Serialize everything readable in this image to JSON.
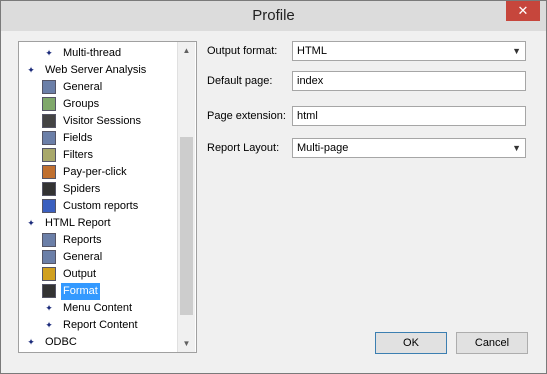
{
  "window": {
    "title": "Profile",
    "close_glyph": "✕"
  },
  "tree": {
    "items": [
      {
        "label": "Multi-thread",
        "icon": "bullet-icon"
      },
      {
        "label": "Web Server Analysis",
        "icon": "bullet-icon"
      },
      {
        "label": "General",
        "icon": "settings-icon"
      },
      {
        "label": "Groups",
        "icon": "groups-icon"
      },
      {
        "label": "Visitor Sessions",
        "icon": "visitor-icon"
      },
      {
        "label": "Fields",
        "icon": "fields-icon"
      },
      {
        "label": "Filters",
        "icon": "filters-icon"
      },
      {
        "label": "Pay-per-click",
        "icon": "pay-per-click-icon"
      },
      {
        "label": "Spiders",
        "icon": "spider-icon"
      },
      {
        "label": "Custom reports",
        "icon": "custom-reports-icon"
      },
      {
        "label": "HTML Report",
        "icon": "bullet-icon"
      },
      {
        "label": "Reports",
        "icon": "reports-icon"
      },
      {
        "label": "General",
        "icon": "settings-icon"
      },
      {
        "label": "Output",
        "icon": "output-icon"
      },
      {
        "label": "Format",
        "icon": "format-icon",
        "selected": true
      },
      {
        "label": "Menu Content",
        "icon": "bullet-icon"
      },
      {
        "label": "Report Content",
        "icon": "bullet-icon"
      },
      {
        "label": "ODBC",
        "icon": "bullet-icon"
      }
    ],
    "scroll_up_glyph": "▲",
    "scroll_down_glyph": "▼"
  },
  "form": {
    "output_format": {
      "label": "Output format:",
      "value": "HTML"
    },
    "default_page": {
      "label": "Default page:",
      "value": "index"
    },
    "page_extension": {
      "label": "Page extension:",
      "value": "html"
    },
    "report_layout": {
      "label": "Report Layout:",
      "value": "Multi-page"
    },
    "dropdown_glyph": "▼"
  },
  "buttons": {
    "ok": "OK",
    "cancel": "Cancel"
  },
  "colors": {
    "selection": "#3399ff",
    "close": "#c6463c",
    "bullet": "#1a2a7a"
  }
}
